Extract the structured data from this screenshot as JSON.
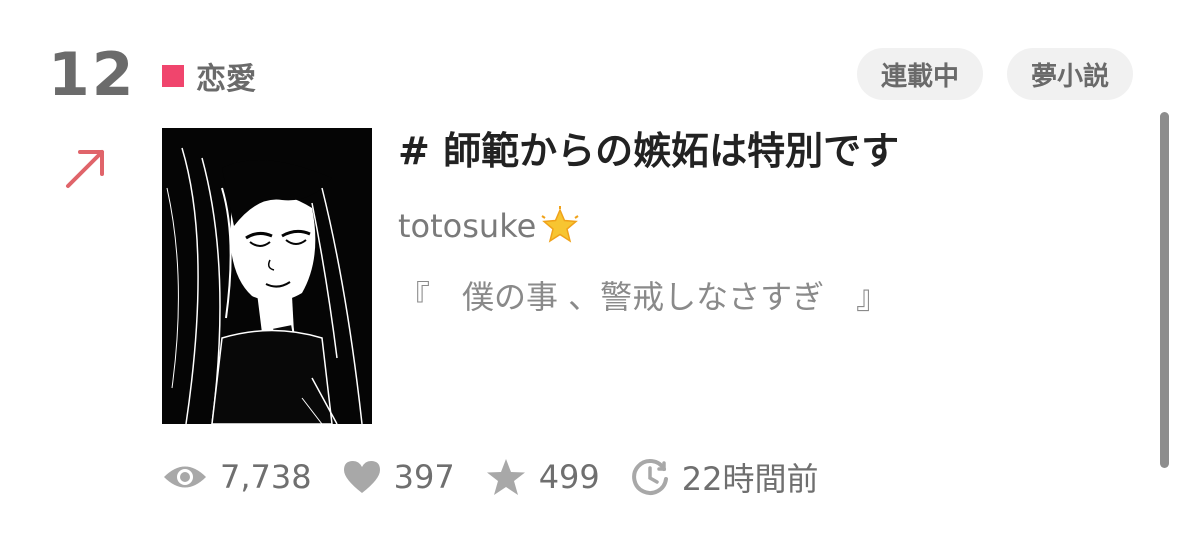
{
  "item": {
    "rank": "12",
    "category": {
      "label": "恋愛",
      "color": "#f0456d"
    },
    "tags": [
      "連載中",
      "夢小説"
    ],
    "title": "# 師範からの嫉妬は特別です",
    "author": {
      "name": "totosuke",
      "badge_icon": "glowing-star-icon"
    },
    "synopsis": "『　僕の事 、警戒しなさすぎ　』",
    "stats": {
      "views": "7,738",
      "likes": "397",
      "stars": "499",
      "updated": "22時間前"
    },
    "trend_icon": "arrow-up-right-icon",
    "trend_color": "#e0646a"
  }
}
